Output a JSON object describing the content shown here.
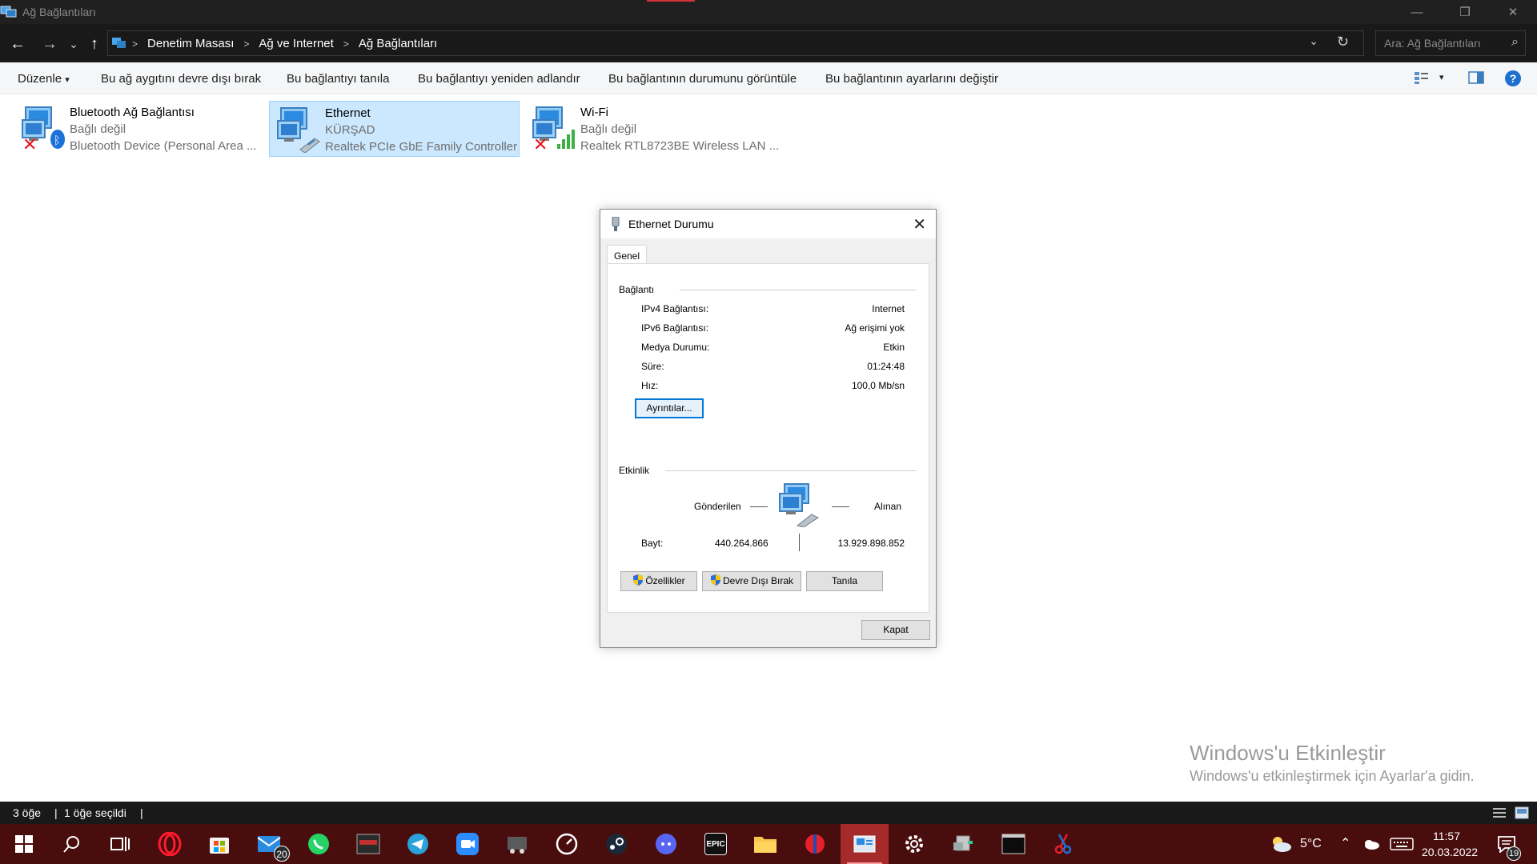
{
  "window": {
    "title": "Ağ Bağlantıları",
    "min_glyph": "—",
    "max_glyph": "❐",
    "close_glyph": "✕"
  },
  "nav": {
    "back": "←",
    "forward": "→",
    "recent": "⌄",
    "up": "↑"
  },
  "breadcrumbs": [
    "Denetim Masası",
    "Ağ ve Internet",
    "Ağ Bağlantıları"
  ],
  "breadcrumb_sep": ">",
  "address_dropdown": "⌄",
  "refresh": "↻",
  "search": {
    "placeholder": "Ara: Ağ Bağlantıları",
    "icon": "⌕"
  },
  "commands": {
    "organize": "Düzenle",
    "organize_arrow": "▾",
    "disable_device": "Bu ağ aygıtını devre dışı bırak",
    "diagnose": "Bu bağlantıyı tanıla",
    "rename": "Bu bağlantıyı yeniden adlandır",
    "view_status": "Bu bağlantının durumunu görüntüle",
    "change_settings": "Bu bağlantının ayarlarını değiştir",
    "view_options_arrow": "▾",
    "help": "?"
  },
  "connections": [
    {
      "name": "Bluetooth Ağ Bağlantısı",
      "status": "Bağlı değil",
      "device": "Bluetooth Device (Personal Area ..."
    },
    {
      "name": "Ethernet",
      "status": "KÜRŞAD",
      "device": "Realtek PCIe GbE Family Controller"
    },
    {
      "name": "Wi-Fi",
      "status": "Bağlı değil",
      "device": "Realtek RTL8723BE Wireless LAN ..."
    }
  ],
  "dialog": {
    "title": "Ethernet Durumu",
    "close": "✕",
    "tab": "Genel",
    "connection_group": "Bağlantı",
    "rows": [
      {
        "key": "IPv4 Bağlantısı:",
        "value": "Internet"
      },
      {
        "key": "IPv6 Bağlantısı:",
        "value": "Ağ erişimi yok"
      },
      {
        "key": "Medya Durumu:",
        "value": "Etkin"
      },
      {
        "key": "Süre:",
        "value": "01:24:48"
      },
      {
        "key": "Hız:",
        "value": "100,0 Mb/sn"
      }
    ],
    "details_button": "Ayrıntılar...",
    "activity_group": "Etkinlik",
    "sent_label": "Gönderilen",
    "received_label": "Alınan",
    "bytes_label": "Bayt:",
    "bytes_sent": "440.264.866",
    "bytes_received": "13.929.898.852",
    "properties_button": "Özellikler",
    "disable_button": "Devre Dışı Bırak",
    "diagnose_button": "Tanıla",
    "close_button": "Kapat"
  },
  "watermark": {
    "title": "Windows'u Etkinleştir",
    "subtitle": "Windows'u etkinleştirmek için Ayarlar'a gidin."
  },
  "statusbar": {
    "items_count": "3 öğe",
    "selected_count": "1 öğe seçildi",
    "divider": "|"
  },
  "taskbar": {
    "mail_badge": "20",
    "epic_text": "EPIC",
    "weather_temp": "5°C",
    "time": "11:57",
    "date": "20.03.2022",
    "notification_badge": "19"
  },
  "colors": {
    "taskbar_bg": "#4a0d0d",
    "taskbar_active": "#a52a2a",
    "selection_bg": "#cce8ff",
    "focus_blue": "#0078d7",
    "red_x": "#e81123"
  }
}
